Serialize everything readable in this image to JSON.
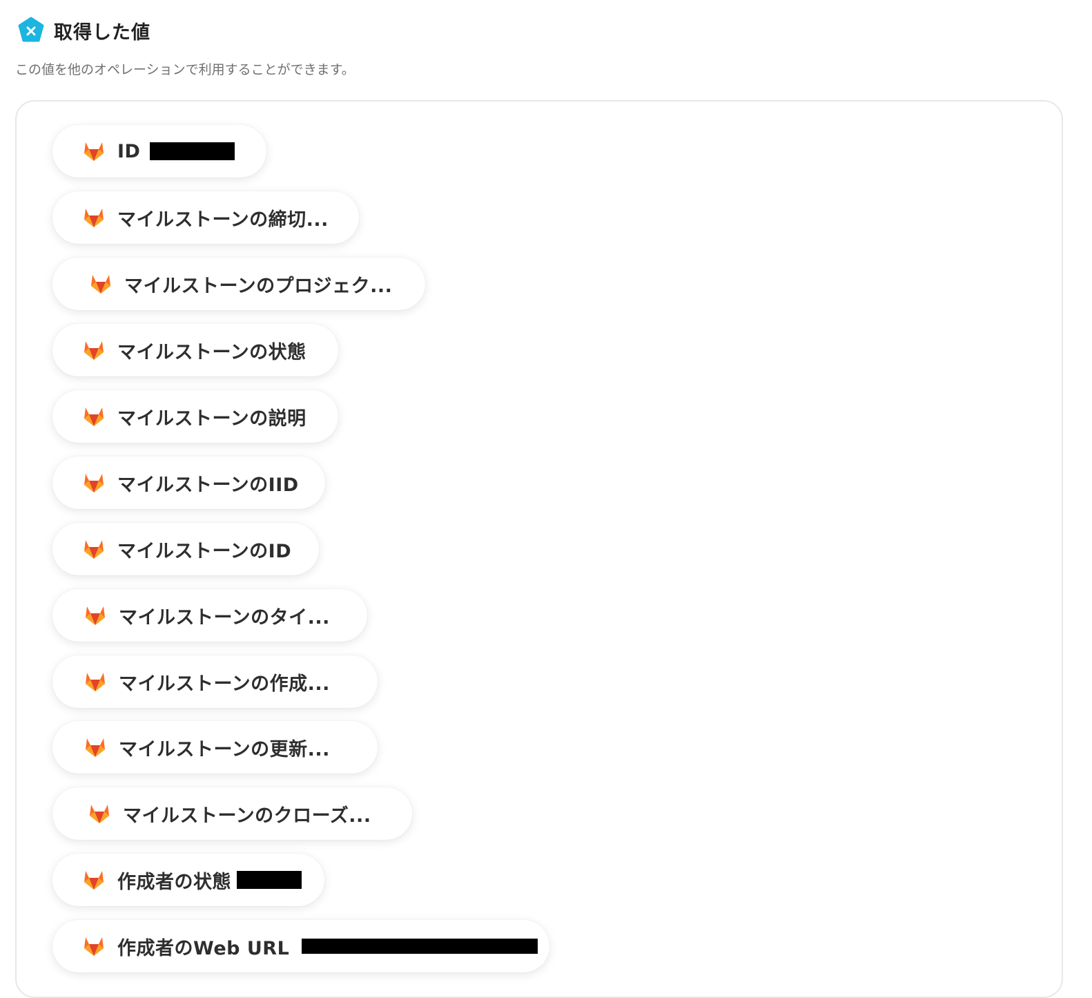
{
  "header": {
    "title": "取得した値",
    "icon": "yoom-x-icon",
    "icon_color": "#1cb5e0"
  },
  "subtitle": "この値を他のオペレーションで利用することができます。",
  "items_icon": "gitlab-icon",
  "items": [
    {
      "label": "ID"
    },
    {
      "label": "マイルストーンの締切..."
    },
    {
      "label": "マイルストーンのプロジェク..."
    },
    {
      "label": "マイルストーンの状態"
    },
    {
      "label": "マイルストーンの説明"
    },
    {
      "label": "マイルストーンのIID"
    },
    {
      "label": "マイルストーンのID"
    },
    {
      "label": "マイルストーンのタイ..."
    },
    {
      "label": "マイルストーンの作成..."
    },
    {
      "label": "マイルストーンの更新..."
    },
    {
      "label": "マイルストーンのクローズ..."
    },
    {
      "label": "作成者の状態"
    },
    {
      "label": "作成者のWeb URL"
    }
  ]
}
